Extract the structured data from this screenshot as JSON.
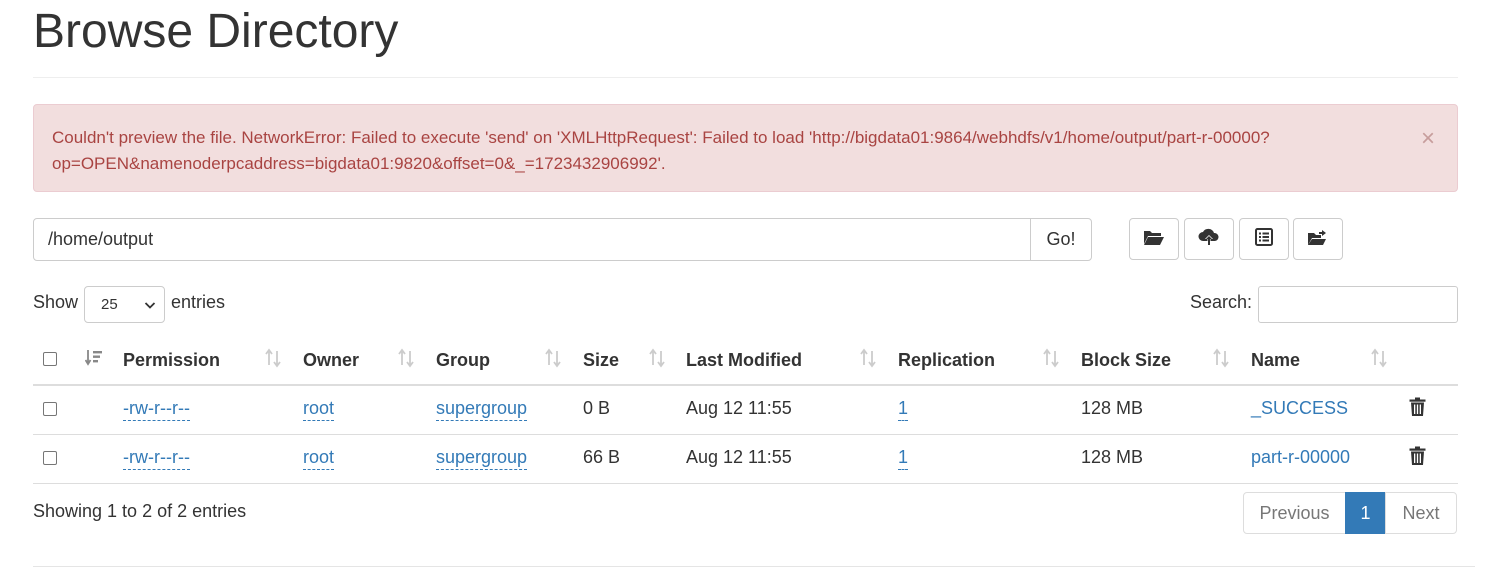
{
  "page": {
    "title": "Browse Directory"
  },
  "alert": {
    "message": "Couldn't preview the file. NetworkError: Failed to execute 'send' on 'XMLHttpRequest': Failed to load 'http://bigdata01:9864/webhdfs/v1/home/output/part-r-00000?op=OPEN&namenoderpcaddress=bigdata01:9820&offset=0&_=1723432906992'.",
    "close": "×"
  },
  "path": {
    "value": "/home/output",
    "go_label": "Go!"
  },
  "toolbar": {
    "buttons": [
      {
        "icon": "folder-open-icon"
      },
      {
        "icon": "cloud-upload-icon"
      },
      {
        "icon": "list-alt-icon"
      },
      {
        "icon": "folder-move-icon"
      }
    ]
  },
  "length": {
    "show_label": "Show",
    "selected": "25",
    "entries_label": "entries"
  },
  "search": {
    "label": "Search:",
    "value": ""
  },
  "table": {
    "columns": [
      "Permission",
      "Owner",
      "Group",
      "Size",
      "Last Modified",
      "Replication",
      "Block Size",
      "Name"
    ],
    "rows": [
      {
        "permission": "-rw-r--r--",
        "owner": "root",
        "group": "supergroup",
        "size": "0 B",
        "modified": "Aug 12 11:55",
        "replication": "1",
        "block_size": "128 MB",
        "name": "_SUCCESS"
      },
      {
        "permission": "-rw-r--r--",
        "owner": "root",
        "group": "supergroup",
        "size": "66 B",
        "modified": "Aug 12 11:55",
        "replication": "1",
        "block_size": "128 MB",
        "name": "part-r-00000"
      }
    ]
  },
  "footer": {
    "info": "Showing 1 to 2 of 2 entries"
  },
  "pagination": {
    "previous": "Previous",
    "current": "1",
    "next": "Next"
  },
  "colors": {
    "link": "#337ab7",
    "alert_bg": "#f2dede",
    "alert_text": "#a94442",
    "active_page": "#337ab7"
  }
}
